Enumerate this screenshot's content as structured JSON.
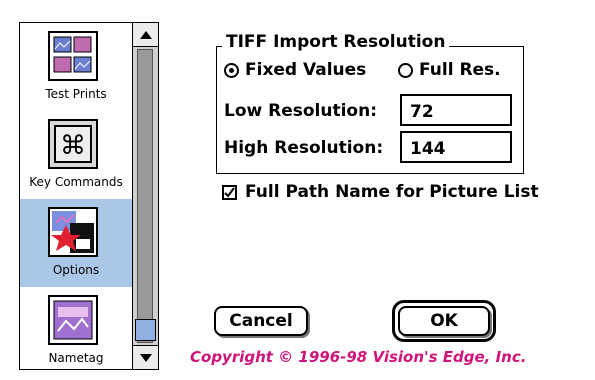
{
  "sidebar": {
    "items": [
      {
        "label": "Test Prints",
        "icon": "test-prints-icon"
      },
      {
        "label": "Key Commands",
        "icon": "command-key-icon"
      },
      {
        "label": "Options",
        "icon": "options-icon"
      },
      {
        "label": "Nametag",
        "icon": "nametag-icon"
      }
    ],
    "selected": "Options"
  },
  "tiff_group": {
    "title": "TIFF Import Resolution",
    "radio_fixed": "Fixed Values",
    "radio_full": "Full Res.",
    "selected_radio": "Fixed Values",
    "low_label": "Low Resolution:",
    "low_value": "72",
    "high_label": "High Resolution:",
    "high_value": "144"
  },
  "options": {
    "full_path_label": "Full Path Name for Picture List",
    "full_path_checked": true
  },
  "buttons": {
    "cancel": "Cancel",
    "ok": "OK"
  },
  "footer": {
    "copyright": "Copyright © 1996-98 Vision's Edge, Inc.",
    "copyright_color": "#d0147a"
  },
  "colors": {
    "selection": "#a9c8e8",
    "scrollbar_thumb": "#8fb0e0"
  }
}
